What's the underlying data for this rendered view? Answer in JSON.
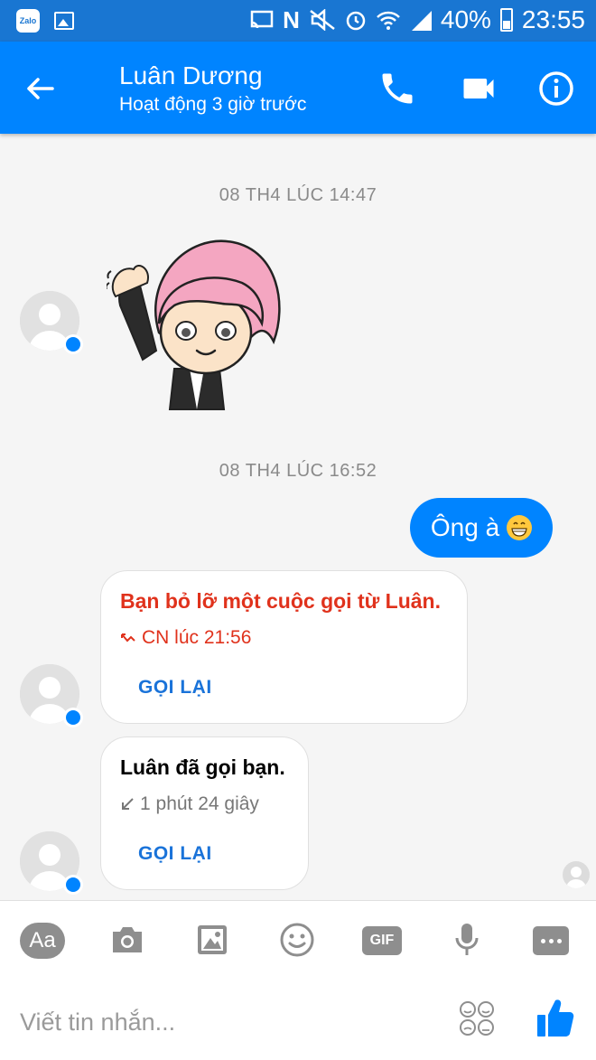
{
  "status_bar": {
    "battery": "40%",
    "time": "23:55",
    "app_icon_label": "Zalo",
    "icons": [
      "zalo-icon",
      "gallery-icon",
      "cast-icon",
      "nfc-icon",
      "mute-icon",
      "alarm-icon",
      "wifi-icon",
      "signal-icon",
      "battery-icon"
    ]
  },
  "header": {
    "contact_name": "Luân Dương",
    "status": "Hoạt động 3 giờ trước",
    "icons": [
      "back-arrow-icon",
      "phone-icon",
      "video-camera-icon",
      "info-icon"
    ]
  },
  "messages": {
    "timestamp_1": "08 TH4 LÚC 14:47",
    "timestamp_2": "08 TH4 LÚC 16:52",
    "outgoing_text": "Ông à",
    "missed_call": {
      "title": "Bạn bỏ lỡ một cuộc gọi từ Luân.",
      "time": "CN lúc 21:56",
      "action": "GỌI LẠI"
    },
    "incoming_call": {
      "title": "Luân đã gọi bạn.",
      "duration": "1 phút 24 giây",
      "action": "GỌI LẠI"
    }
  },
  "composer": {
    "aa_label": "Aa",
    "gif_label": "GIF",
    "placeholder": "Viết tin nhắn...",
    "icons": [
      "camera-icon",
      "image-icon",
      "emoji-icon",
      "microphone-icon",
      "more-icon",
      "sticker-faces-icon",
      "thumbs-up-icon"
    ]
  },
  "colors": {
    "header_blue": "#0084ff",
    "status_bar_blue": "#1976d2",
    "missed_red": "#e0321c",
    "action_blue": "#1a73d9"
  }
}
